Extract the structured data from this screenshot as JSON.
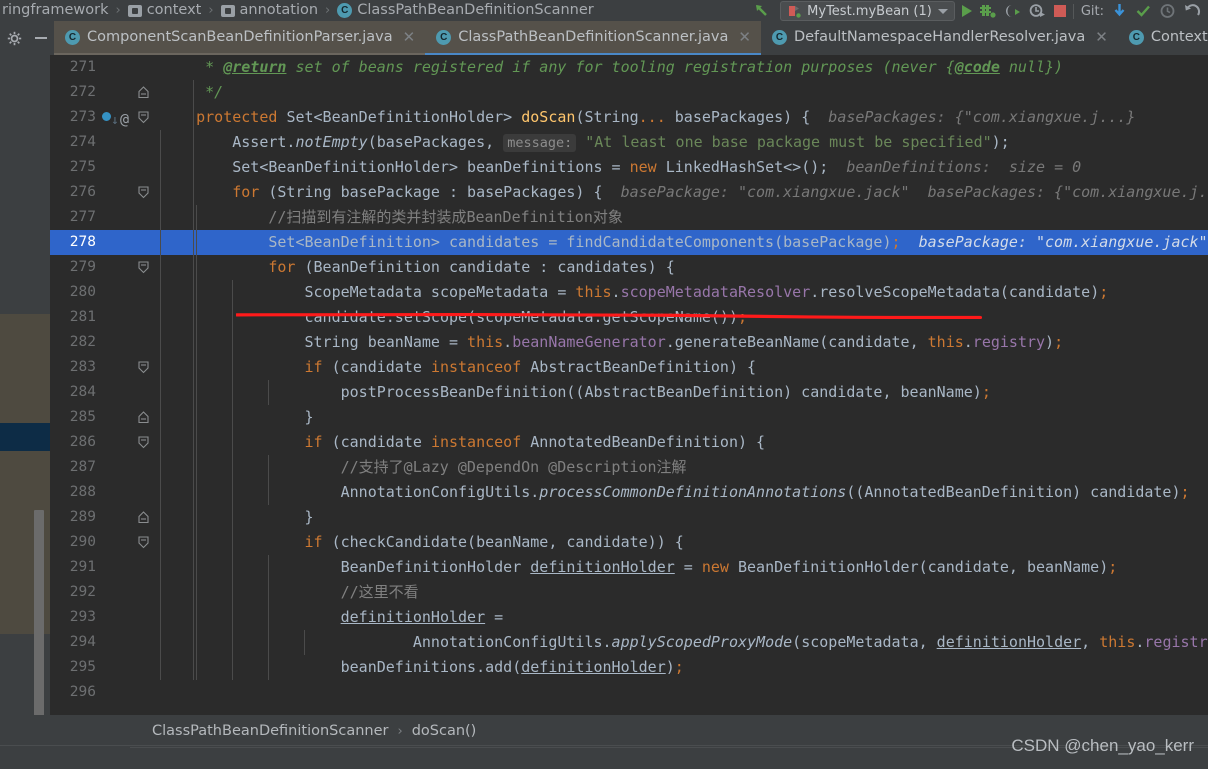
{
  "navbar": {
    "items": [
      {
        "label": "ringframework",
        "icon": "package-icon"
      },
      {
        "label": "context",
        "icon": "package-icon"
      },
      {
        "label": "annotation",
        "icon": "package-icon"
      },
      {
        "label": "ClassPathBeanDefinitionScanner",
        "icon": "class-icon"
      }
    ],
    "separator": "›"
  },
  "toolbar": {
    "run_config": "MyTest.myBean (1)",
    "git_label": "Git:",
    "buttons": [
      {
        "name": "run-button",
        "tooltip": "Run"
      },
      {
        "name": "debug-button",
        "tooltip": "Debug"
      },
      {
        "name": "run-coverage-button",
        "tooltip": "Run with Coverage"
      },
      {
        "name": "profile-button",
        "tooltip": "Profile"
      },
      {
        "name": "stop-button",
        "tooltip": "Stop"
      },
      {
        "name": "git-update-button",
        "tooltip": "Update Project"
      },
      {
        "name": "git-commit-button",
        "tooltip": "Commit"
      },
      {
        "name": "git-history-button",
        "tooltip": "History"
      },
      {
        "name": "git-rollback-button",
        "tooltip": "Rollback"
      }
    ]
  },
  "tabs": [
    {
      "label": "ComponentScanBeanDefinitionParser.java",
      "icon": "class-icon",
      "state": "inactive",
      "closable": true
    },
    {
      "label": "ClassPathBeanDefinitionScanner.java",
      "icon": "class-icon",
      "state": "selected",
      "closable": true
    },
    {
      "label": "DefaultNamespaceHandlerResolver.java",
      "icon": "class-icon",
      "state": "inactive",
      "closable": true
    },
    {
      "label": "ContextNa",
      "icon": "class-icon",
      "state": "inactive",
      "closable": false
    }
  ],
  "editor": {
    "highlighted_line": 278,
    "first_line": 271,
    "last_line": 296,
    "lines": [
      {
        "num": "271",
        "indent": 0,
        "fold": "",
        "html": "<span class='jdoc'>     * </span><span class='jtag'>@return</span><span class='jdoc'> set of beans registered if any for tooling registration purposes (never {</span><span class='jtag'>@code</span><span class='jdoc'> null})</span>"
      },
      {
        "num": "272",
        "indent": 0,
        "fold": "end",
        "html": "<span class='jdoc'>     */</span>"
      },
      {
        "num": "273",
        "indent": 0,
        "fold": "start",
        "bookmark": true,
        "at": true,
        "html": "<span class='kw'>    protected </span>Set&lt;BeanDefinitionHolder&gt; <span class='mth'>doScan</span>(String<span class='kw'>... </span>basePackages) {<span class='hint'>  basePackages: {\"com.xiangxue.j...}</span>"
      },
      {
        "num": "274",
        "indent": 1,
        "fold": "",
        "html": "        Assert.<span class='stat'>notEmpty</span>(basePackages, <span class='hint-b'>message:</span> <span class='str'>\"At least one base package must be specified\"</span>);"
      },
      {
        "num": "275",
        "indent": 1,
        "fold": "",
        "html": "        Set&lt;BeanDefinitionHolder&gt; beanDefinitions = <span class='kw'>new </span>LinkedHashSet&lt;&gt;();<span class='hint'>  beanDefinitions:  size = 0</span>"
      },
      {
        "num": "276",
        "indent": 1,
        "fold": "start",
        "html": "        <span class='kw'>for </span>(String basePackage : basePackages) {<span class='hint'>  basePackage: \"com.xiangxue.jack\"  basePackages: {\"com.xiangxue.j...</span>"
      },
      {
        "num": "277",
        "indent": 2,
        "fold": "",
        "html": "            <span class='cmt'>//扫描到有注解的类并封装成BeanDefinition对象</span>"
      },
      {
        "num": "278",
        "indent": 2,
        "fold": "",
        "highlight": true,
        "html": "            Set&lt;BeanDefinition&gt; candidates = findCandidateComponents(basePackage)<span class='kw'>;</span><span class='hint'>  basePackage: \"com.xiangxue.jack\"</span>"
      },
      {
        "num": "279",
        "indent": 2,
        "fold": "start",
        "html": "            <span class='kw'>for </span>(BeanDefinition candidate : candidates) {"
      },
      {
        "num": "280",
        "indent": 3,
        "fold": "",
        "html": "                ScopeMetadata scopeMetadata = <span class='kw'>this</span>.<span class='fld'>scopeMetadataResolver</span>.resolveScopeMetadata(candidate)<span class='kw'>;</span>"
      },
      {
        "num": "281",
        "indent": 3,
        "fold": "",
        "html": "                candidate.setScope(scopeMetadata.getScopeName())<span class='kw'>;</span>"
      },
      {
        "num": "282",
        "indent": 3,
        "fold": "",
        "html": "                String beanName = <span class='kw'>this</span>.<span class='fld'>beanNameGenerator</span>.generateBeanName(candidate, <span class='kw'>this</span>.<span class='fld'>registry</span>)<span class='kw'>;</span>"
      },
      {
        "num": "283",
        "indent": 3,
        "fold": "start",
        "html": "                <span class='kw'>if </span>(candidate <span class='kw'>instanceof </span>AbstractBeanDefinition) {"
      },
      {
        "num": "284",
        "indent": 4,
        "fold": "",
        "html": "                    postProcessBeanDefinition((AbstractBeanDefinition) candidate, beanName)<span class='kw'>;</span>"
      },
      {
        "num": "285",
        "indent": 3,
        "fold": "end",
        "html": "                }"
      },
      {
        "num": "286",
        "indent": 3,
        "fold": "start",
        "html": "                <span class='kw'>if </span>(candidate <span class='kw'>instanceof </span>AnnotatedBeanDefinition) {"
      },
      {
        "num": "287",
        "indent": 4,
        "fold": "",
        "html": "                    <span class='cmt'>//支持了@Lazy @DependOn @Description注解</span>"
      },
      {
        "num": "288",
        "indent": 4,
        "fold": "",
        "html": "                    AnnotationConfigUtils.<span class='stat'>processCommonDefinitionAnnotations</span>((AnnotatedBeanDefinition) candidate)<span class='kw'>;</span>"
      },
      {
        "num": "289",
        "indent": 3,
        "fold": "end",
        "html": "                }"
      },
      {
        "num": "290",
        "indent": 3,
        "fold": "start",
        "html": "                <span class='kw'>if </span>(checkCandidate(beanName, candidate)) {"
      },
      {
        "num": "291",
        "indent": 4,
        "fold": "",
        "html": "                    BeanDefinitionHolder <span class='ul'>definitionHolder</span> = <span class='kw'>new </span>BeanDefinitionHolder(candidate, beanName)<span class='kw'>;</span>"
      },
      {
        "num": "292",
        "indent": 4,
        "fold": "",
        "html": "                    <span class='cmt'>//这里不看</span>"
      },
      {
        "num": "293",
        "indent": 4,
        "fold": "",
        "html": "                    <span class='ul'>definitionHolder</span> ="
      },
      {
        "num": "294",
        "indent": 5,
        "fold": "",
        "html": "                            AnnotationConfigUtils.<span class='stat'>applyScopedProxyMode</span>(scopeMetadata, <span class='ul'>definitionHolder</span>, <span class='kw'>this</span>.<span class='fld'>registry</span>)"
      },
      {
        "num": "295",
        "indent": 4,
        "fold": "",
        "html": "                    beanDefinitions.add(<span class='ul'>definitionHolder</span>)<span class='kw'>;</span>"
      },
      {
        "num": "296",
        "indent": 0,
        "fold": "",
        "html": ""
      }
    ],
    "annotation": {
      "type": "red-underline",
      "target_line": 278
    }
  },
  "status_bar": {
    "breadcrumb": [
      "ClassPathBeanDefinitionScanner",
      "doScan()"
    ],
    "separator": "›"
  },
  "watermark": "CSDN @chen_yao_kerr",
  "colors": {
    "editor_bg": "#2b2b2b",
    "chrome_bg": "#3c3f41",
    "highlight_line": "#2f65ca",
    "tab_active": "#55514a",
    "accent_blue": "#4a88c7",
    "annotation_red": "#ff1a1a",
    "run_green": "#5a9e4b",
    "stop_red": "#cf5b56"
  }
}
